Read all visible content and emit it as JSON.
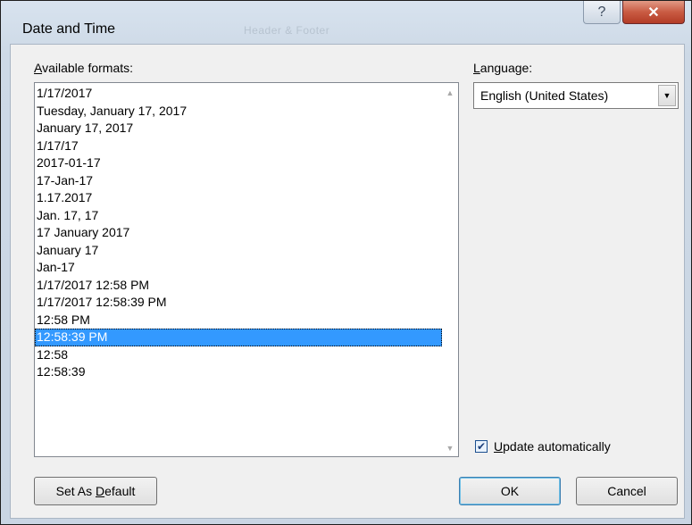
{
  "window": {
    "title": "Date and Time",
    "ghost_title": "Header & Footer",
    "help_glyph": "?",
    "close_glyph": "✕"
  },
  "formats": {
    "label_prefix": "A",
    "label_rest": "vailable formats:",
    "items": [
      "1/17/2017",
      "Tuesday, January 17, 2017",
      "January 17, 2017",
      "1/17/17",
      "2017-01-17",
      "17-Jan-17",
      "1.17.2017",
      "Jan. 17, 17",
      "17 January 2017",
      "January 17",
      "Jan-17",
      "1/17/2017 12:58 PM",
      "1/17/2017 12:58:39 PM",
      "12:58 PM",
      "12:58:39 PM",
      "12:58",
      "12:58:39"
    ],
    "selected": "12:58:39 PM"
  },
  "language": {
    "label_prefix": "L",
    "label_rest": "anguage:",
    "value": "English (United States)"
  },
  "update": {
    "checked": true,
    "label_prefix": "U",
    "label_rest": "pdate automatically"
  },
  "buttons": {
    "set_default_prefix": "Set As ",
    "set_default_mnemonic": "D",
    "set_default_rest": "efault",
    "ok": "OK",
    "cancel": "Cancel"
  },
  "icons": {
    "scroll_up": "scroll-up-arrow-icon",
    "scroll_down": "scroll-down-arrow-icon",
    "dropdown": "chevron-down-icon",
    "check": "checkmark-icon"
  },
  "colors": {
    "selection": "#3399ff",
    "close_button": "#c95b43"
  }
}
